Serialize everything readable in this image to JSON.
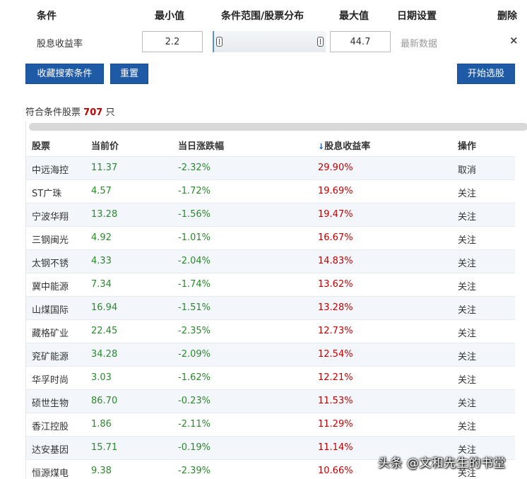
{
  "headers": {
    "condition": "条件",
    "min": "最小值",
    "range": "条件范围/股票分布",
    "max": "最大值",
    "date": "日期设置",
    "delete": "删除"
  },
  "criteria": {
    "name": "股息收益率",
    "min_value": "2.2",
    "max_value": "44.7",
    "date_setting": "最新数据",
    "delete_symbol": "×"
  },
  "buttons": {
    "save": "收藏搜索条件",
    "reset": "重置",
    "start": "开始选股"
  },
  "result": {
    "prefix": "符合条件股票",
    "count": "707",
    "suffix": "只"
  },
  "table": {
    "columns": [
      "股票",
      "当前价",
      "当日涨跌幅",
      "股息收益率",
      "操作"
    ],
    "sort_icon": "↓",
    "rows": [
      {
        "name": "中远海控",
        "price": "11.37",
        "change": "-2.32%",
        "yield": "29.90%",
        "action": "取消"
      },
      {
        "name": "ST广珠",
        "price": "4.57",
        "change": "-1.72%",
        "yield": "19.69%",
        "action": "关注"
      },
      {
        "name": "宁波华翔",
        "price": "13.28",
        "change": "-1.56%",
        "yield": "19.47%",
        "action": "关注"
      },
      {
        "name": "三钢闽光",
        "price": "4.92",
        "change": "-1.01%",
        "yield": "16.67%",
        "action": "关注"
      },
      {
        "name": "太钢不锈",
        "price": "4.33",
        "change": "-2.04%",
        "yield": "14.83%",
        "action": "关注"
      },
      {
        "name": "冀中能源",
        "price": "7.34",
        "change": "-1.74%",
        "yield": "13.62%",
        "action": "关注"
      },
      {
        "name": "山煤国际",
        "price": "16.94",
        "change": "-1.51%",
        "yield": "13.28%",
        "action": "关注"
      },
      {
        "name": "藏格矿业",
        "price": "22.45",
        "change": "-2.35%",
        "yield": "12.73%",
        "action": "关注"
      },
      {
        "name": "兖矿能源",
        "price": "34.28",
        "change": "-2.09%",
        "yield": "12.54%",
        "action": "关注"
      },
      {
        "name": "华孚时尚",
        "price": "3.03",
        "change": "-1.62%",
        "yield": "12.21%",
        "action": "关注"
      },
      {
        "name": "硕世生物",
        "price": "86.70",
        "change": "-0.23%",
        "yield": "11.53%",
        "action": "关注"
      },
      {
        "name": "香江控股",
        "price": "1.86",
        "change": "-2.11%",
        "yield": "11.29%",
        "action": "关注"
      },
      {
        "name": "达安基因",
        "price": "15.71",
        "change": "-0.19%",
        "yield": "11.14%",
        "action": "关注"
      },
      {
        "name": "恒源煤电",
        "price": "9.38",
        "change": "-2.39%",
        "yield": "10.66%",
        "action": "关注"
      }
    ]
  },
  "watermark": "头条 @文和先生的书堂",
  "colors": {
    "button_bg": "#1f5aa6",
    "negative_change": "#2a8a2a",
    "yield_value": "#c00000",
    "count_highlight": "#c00000"
  }
}
